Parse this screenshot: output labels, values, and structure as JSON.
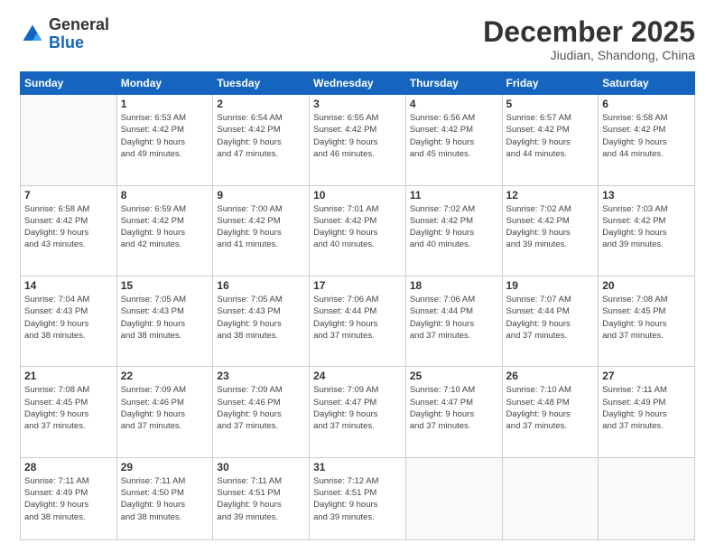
{
  "header": {
    "logo_general": "General",
    "logo_blue": "Blue",
    "month_title": "December 2025",
    "location": "Jiudian, Shandong, China"
  },
  "days_of_week": [
    "Sunday",
    "Monday",
    "Tuesday",
    "Wednesday",
    "Thursday",
    "Friday",
    "Saturday"
  ],
  "weeks": [
    [
      {
        "day": "",
        "info": ""
      },
      {
        "day": "1",
        "info": "Sunrise: 6:53 AM\nSunset: 4:42 PM\nDaylight: 9 hours\nand 49 minutes."
      },
      {
        "day": "2",
        "info": "Sunrise: 6:54 AM\nSunset: 4:42 PM\nDaylight: 9 hours\nand 47 minutes."
      },
      {
        "day": "3",
        "info": "Sunrise: 6:55 AM\nSunset: 4:42 PM\nDaylight: 9 hours\nand 46 minutes."
      },
      {
        "day": "4",
        "info": "Sunrise: 6:56 AM\nSunset: 4:42 PM\nDaylight: 9 hours\nand 45 minutes."
      },
      {
        "day": "5",
        "info": "Sunrise: 6:57 AM\nSunset: 4:42 PM\nDaylight: 9 hours\nand 44 minutes."
      },
      {
        "day": "6",
        "info": "Sunrise: 6:58 AM\nSunset: 4:42 PM\nDaylight: 9 hours\nand 44 minutes."
      }
    ],
    [
      {
        "day": "7",
        "info": "Sunrise: 6:58 AM\nSunset: 4:42 PM\nDaylight: 9 hours\nand 43 minutes."
      },
      {
        "day": "8",
        "info": "Sunrise: 6:59 AM\nSunset: 4:42 PM\nDaylight: 9 hours\nand 42 minutes."
      },
      {
        "day": "9",
        "info": "Sunrise: 7:00 AM\nSunset: 4:42 PM\nDaylight: 9 hours\nand 41 minutes."
      },
      {
        "day": "10",
        "info": "Sunrise: 7:01 AM\nSunset: 4:42 PM\nDaylight: 9 hours\nand 40 minutes."
      },
      {
        "day": "11",
        "info": "Sunrise: 7:02 AM\nSunset: 4:42 PM\nDaylight: 9 hours\nand 40 minutes."
      },
      {
        "day": "12",
        "info": "Sunrise: 7:02 AM\nSunset: 4:42 PM\nDaylight: 9 hours\nand 39 minutes."
      },
      {
        "day": "13",
        "info": "Sunrise: 7:03 AM\nSunset: 4:42 PM\nDaylight: 9 hours\nand 39 minutes."
      }
    ],
    [
      {
        "day": "14",
        "info": "Sunrise: 7:04 AM\nSunset: 4:43 PM\nDaylight: 9 hours\nand 38 minutes."
      },
      {
        "day": "15",
        "info": "Sunrise: 7:05 AM\nSunset: 4:43 PM\nDaylight: 9 hours\nand 38 minutes."
      },
      {
        "day": "16",
        "info": "Sunrise: 7:05 AM\nSunset: 4:43 PM\nDaylight: 9 hours\nand 38 minutes."
      },
      {
        "day": "17",
        "info": "Sunrise: 7:06 AM\nSunset: 4:44 PM\nDaylight: 9 hours\nand 37 minutes."
      },
      {
        "day": "18",
        "info": "Sunrise: 7:06 AM\nSunset: 4:44 PM\nDaylight: 9 hours\nand 37 minutes."
      },
      {
        "day": "19",
        "info": "Sunrise: 7:07 AM\nSunset: 4:44 PM\nDaylight: 9 hours\nand 37 minutes."
      },
      {
        "day": "20",
        "info": "Sunrise: 7:08 AM\nSunset: 4:45 PM\nDaylight: 9 hours\nand 37 minutes."
      }
    ],
    [
      {
        "day": "21",
        "info": "Sunrise: 7:08 AM\nSunset: 4:45 PM\nDaylight: 9 hours\nand 37 minutes."
      },
      {
        "day": "22",
        "info": "Sunrise: 7:09 AM\nSunset: 4:46 PM\nDaylight: 9 hours\nand 37 minutes."
      },
      {
        "day": "23",
        "info": "Sunrise: 7:09 AM\nSunset: 4:46 PM\nDaylight: 9 hours\nand 37 minutes."
      },
      {
        "day": "24",
        "info": "Sunrise: 7:09 AM\nSunset: 4:47 PM\nDaylight: 9 hours\nand 37 minutes."
      },
      {
        "day": "25",
        "info": "Sunrise: 7:10 AM\nSunset: 4:47 PM\nDaylight: 9 hours\nand 37 minutes."
      },
      {
        "day": "26",
        "info": "Sunrise: 7:10 AM\nSunset: 4:48 PM\nDaylight: 9 hours\nand 37 minutes."
      },
      {
        "day": "27",
        "info": "Sunrise: 7:11 AM\nSunset: 4:49 PM\nDaylight: 9 hours\nand 37 minutes."
      }
    ],
    [
      {
        "day": "28",
        "info": "Sunrise: 7:11 AM\nSunset: 4:49 PM\nDaylight: 9 hours\nand 38 minutes."
      },
      {
        "day": "29",
        "info": "Sunrise: 7:11 AM\nSunset: 4:50 PM\nDaylight: 9 hours\nand 38 minutes."
      },
      {
        "day": "30",
        "info": "Sunrise: 7:11 AM\nSunset: 4:51 PM\nDaylight: 9 hours\nand 39 minutes."
      },
      {
        "day": "31",
        "info": "Sunrise: 7:12 AM\nSunset: 4:51 PM\nDaylight: 9 hours\nand 39 minutes."
      },
      {
        "day": "",
        "info": ""
      },
      {
        "day": "",
        "info": ""
      },
      {
        "day": "",
        "info": ""
      }
    ]
  ]
}
